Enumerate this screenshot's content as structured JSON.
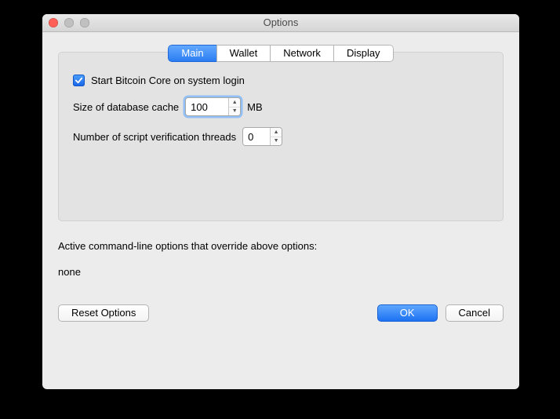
{
  "window": {
    "title": "Options"
  },
  "tabs": [
    {
      "label": "Main",
      "selected": true
    },
    {
      "label": "Wallet",
      "selected": false
    },
    {
      "label": "Network",
      "selected": false
    },
    {
      "label": "Display",
      "selected": false
    }
  ],
  "main": {
    "start_on_login_label": "Start Bitcoin Core on system login",
    "start_on_login_checked": true,
    "db_cache_label": "Size of database cache",
    "db_cache_value": "100",
    "db_cache_unit": "MB",
    "threads_label": "Number of script verification threads",
    "threads_value": "0"
  },
  "override": {
    "label": "Active command-line options that override above options:",
    "value": "none"
  },
  "buttons": {
    "reset": "Reset Options",
    "ok": "OK",
    "cancel": "Cancel"
  }
}
